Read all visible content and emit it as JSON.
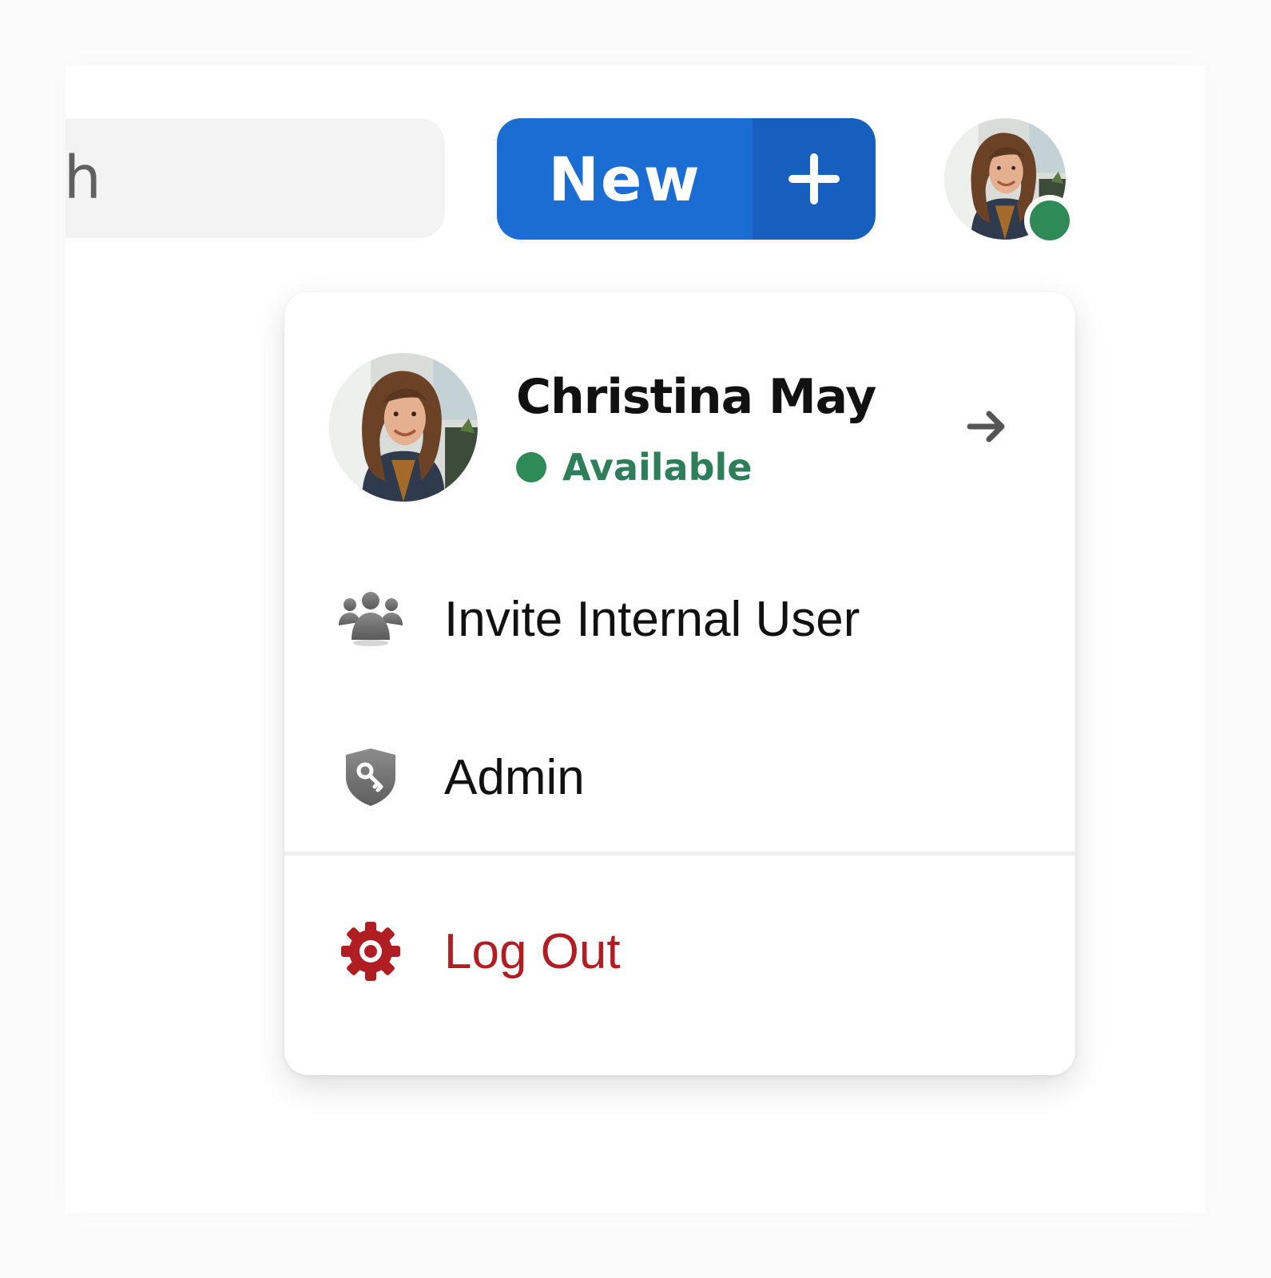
{
  "search": {
    "placeholder_visible": "arch"
  },
  "new_button": {
    "label": "New",
    "icon": "plus-icon",
    "color": "#1b6dd4",
    "split_color": "#165fbf"
  },
  "top_avatar": {
    "icon": "avatar",
    "presence_status": "available",
    "presence_color": "#2e8b57"
  },
  "menu": {
    "profile": {
      "name": "Christina May",
      "status": "Available",
      "status_color": "#2e7d5b",
      "arrow_icon": "arrow-right-icon"
    },
    "items": [
      {
        "label": "Invite Internal User",
        "icon": "users-icon"
      },
      {
        "label": "Admin",
        "icon": "shield-key-icon"
      }
    ],
    "logout": {
      "label": "Log Out",
      "icon": "gear-icon",
      "color": "#b01e23"
    }
  }
}
